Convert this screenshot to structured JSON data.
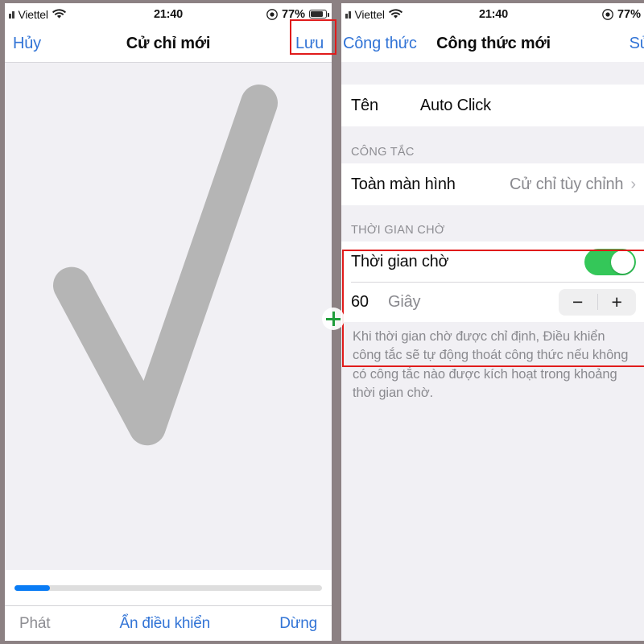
{
  "status_bar": {
    "carrier": "Viettel",
    "time": "21:40",
    "battery_percent": "77%",
    "wifi_icon": "wifi-icon",
    "signal_icon": "signal-bars-icon",
    "battery_icon": "battery-icon",
    "rotation_lock_icon": "rotation-lock-icon"
  },
  "left_phone": {
    "nav": {
      "cancel_label": "Hủy",
      "title": "Cử chỉ mới",
      "save_label": "Lưu"
    },
    "canvas": {
      "gesture_name": "checkmark-stroke",
      "stroke_color": "#b5b5b5",
      "background": "#f1f0f4"
    },
    "scrubber": {
      "progress_percent": "11.5",
      "fill_color": "#0a7cf5",
      "track_color": "#dedede"
    },
    "toolbar": {
      "play_label": "Phát",
      "hide_controls_label": "Ẩn điều khiển",
      "stop_label": "Dừng"
    }
  },
  "right_phone": {
    "nav": {
      "back_label": "Công thức",
      "title": "Công thức mới",
      "action_label": "Sử"
    },
    "name_row": {
      "label": "Tên",
      "value": "Auto Click"
    },
    "switch_section": {
      "header": "CÔNG TẮC",
      "row_label": "Toàn màn hình",
      "row_detail": "Cử chỉ tùy chỉnh",
      "chevron": "›"
    },
    "timeout_section": {
      "header": "THỜI GIAN CHỜ",
      "toggle_label": "Thời gian chờ",
      "toggle_on": "true",
      "toggle_color": "#34c759",
      "value": "60",
      "unit": "Giây",
      "stepper_minus": "−",
      "stepper_plus": "+",
      "footnote": "Khi thời gian chờ được chỉ định, Điều khiển công tắc sẽ tự động thoát công thức nếu không có công tắc nào được kích hoạt trong khoảng thời gian chờ."
    }
  },
  "annotations": {
    "highlight_color": "#e01b1b",
    "save_button_box": "redbox-save-button",
    "timeout_section_box": "redbox-timeout-section",
    "cursor_marker": "green-plus-marker",
    "cursor_color": "#1f9d3a"
  }
}
